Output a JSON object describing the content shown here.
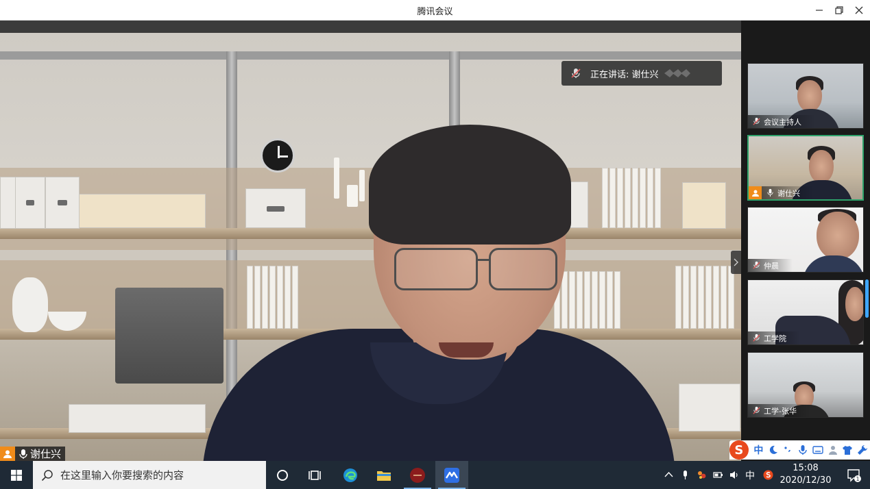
{
  "window": {
    "title": "腾讯会议"
  },
  "main_video": {
    "speaking_prefix": "正在讲话: ",
    "speaking_name": "谢仕兴",
    "speaker_label": "谢仕兴"
  },
  "participants": [
    {
      "name": "会议主持人",
      "muted": true,
      "is_host": false,
      "active": false
    },
    {
      "name": "谢仕兴",
      "muted": false,
      "is_host": true,
      "active": true
    },
    {
      "name": "仲晨",
      "muted": true,
      "is_host": false,
      "active": false
    },
    {
      "name": "工学院",
      "muted": true,
      "is_host": false,
      "active": false
    },
    {
      "name": "工学-张华",
      "muted": true,
      "is_host": false,
      "active": false
    }
  ],
  "ime_bar": {
    "mode": "中"
  },
  "taskbar": {
    "search_placeholder": "在这里输入你要搜索的内容",
    "app_icons": [
      "task-view-icon",
      "edge-browser-icon",
      "file-explorer-icon",
      "app-red-icon",
      "tencent-meeting-icon"
    ],
    "input_mode": "中",
    "time": "15:08",
    "date": "2020/12/30",
    "notifications": "1"
  },
  "colors": {
    "host_badge": "#f08c1a",
    "active_border": "#2ea36b",
    "taskbar": "#1f2a36"
  }
}
